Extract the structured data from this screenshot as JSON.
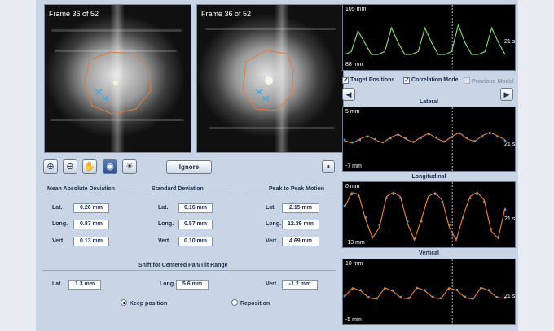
{
  "images": {
    "left_frame": "Frame 36 of 52",
    "right_frame": "Frame 36 of 52"
  },
  "toolbar": {
    "zoom_in_icon": "⊕",
    "zoom_out_icon": "⊖",
    "pan_icon": "✋",
    "window_level_icon": "◉",
    "brightness_icon": "☀",
    "ignore_label": "Ignore",
    "save_icon": "▪"
  },
  "stats": {
    "mean_abs_dev": {
      "title": "Mean Absolute Deviation",
      "rows": [
        {
          "label": "Lat.",
          "value": "0.26 mm"
        },
        {
          "label": "Long.",
          "value": "0.87 mm"
        },
        {
          "label": "Vert.",
          "value": "0.13 mm"
        }
      ]
    },
    "std_dev": {
      "title": "Standard Deviation",
      "rows": [
        {
          "label": "Lat.",
          "value": "0.16 mm"
        },
        {
          "label": "Long.",
          "value": "0.57 mm"
        },
        {
          "label": "Vert.",
          "value": "0.10 mm"
        }
      ]
    },
    "peak_to_peak": {
      "title": "Peak to Peak Motion",
      "rows": [
        {
          "label": "Lat.",
          "value": "2.15 mm"
        },
        {
          "label": "Long.",
          "value": "12.39 mm"
        },
        {
          "label": "Vert.",
          "value": "4.69 mm"
        }
      ]
    }
  },
  "shift": {
    "title": "Shift for Centered Pan/Tilt Range",
    "lat_label": "Lat.",
    "lat_value": "1.3 mm",
    "long_label": "Long.",
    "long_value": "5.6 mm",
    "vert_label": "Vert.",
    "vert_value": "-1.2 mm"
  },
  "options": {
    "keep_position": "Keep position",
    "reposition": "Reposition",
    "selected": "keep_position"
  },
  "checkboxes": {
    "target_positions": "Target Positions",
    "correlation_model": "Correlation Model",
    "previous_model": "Previous Model"
  },
  "nav": {
    "prev": "◀",
    "next": "▶"
  },
  "colors": {
    "breathing_trace": "#7fd36a",
    "model_trace": "#e07a2e",
    "target_points": "#3da6e8",
    "contour": "#e07a3c"
  },
  "chart_data": [
    {
      "type": "line",
      "title": "",
      "ymax_label": "105 mm",
      "ymin_label": "88 mm",
      "time_label": "21 s",
      "ylim": [
        88,
        105
      ],
      "series": [
        {
          "values": [
            91,
            92,
            99,
            95,
            91,
            91,
            92,
            100,
            95,
            91,
            91,
            92,
            100,
            95,
            91,
            91,
            92,
            101,
            95,
            91,
            91,
            92,
            100,
            95,
            91
          ]
        }
      ]
    },
    {
      "type": "line",
      "title": "Lateral",
      "ymax_label": "5 mm",
      "ymin_label": "-7 mm",
      "time_label": "21 s",
      "ylim": [
        -7,
        5
      ],
      "series": [
        {
          "values": [
            -1.0,
            -1.6,
            -1.0,
            -0.2,
            -0.8,
            -1.6,
            -0.6,
            0.2,
            -0.6,
            -1.5,
            -0.5,
            0.4,
            -0.4,
            -1.4,
            -0.4,
            0.6,
            -0.5,
            -1.3,
            -0.2,
            0.6,
            -0.2,
            -1.2
          ]
        },
        {
          "values": [
            -1.2,
            -1.8,
            -0.8,
            0.0,
            -1.0,
            -1.7,
            -0.4,
            0.4,
            -0.8,
            -1.6,
            -0.3,
            0.6,
            -0.6,
            -1.5,
            -0.2,
            0.8,
            -0.7,
            -1.4,
            0.0,
            0.9,
            0.0,
            -1.0
          ]
        }
      ]
    },
    {
      "type": "line",
      "title": "Longitudinal",
      "ymax_label": "0 mm",
      "ymin_label": "-13 mm",
      "time_label": "21 s",
      "ylim": [
        -13,
        0
      ],
      "series": [
        {
          "values": [
            -4,
            -1,
            -1.5,
            -7,
            -12,
            -9,
            -2,
            -1,
            -2,
            -8,
            -12.5,
            -8,
            -2,
            -1,
            -3,
            -9,
            -12.5,
            -7,
            -2,
            -1,
            -3,
            -10,
            -12,
            -5
          ]
        },
        {
          "values": [
            -4.5,
            -0.6,
            -1,
            -7.5,
            -12.3,
            -9.5,
            -1.6,
            -0.5,
            -1.6,
            -8.5,
            -12.8,
            -7.5,
            -1.5,
            -0.6,
            -2.6,
            -9.5,
            -12.9,
            -6.5,
            -1.5,
            -0.5,
            -2.5,
            -10.5,
            -12.4,
            -4.5
          ]
        }
      ]
    },
    {
      "type": "line",
      "title": "Vertical",
      "ymax_label": "10 mm",
      "ymin_label": "-5 mm",
      "time_label": "21 s",
      "ylim": [
        -5,
        10
      ],
      "series": [
        {
          "values": [
            1.5,
            3.8,
            3.3,
            1.2,
            0.8,
            3.8,
            3.2,
            1.2,
            0.9,
            3.9,
            3.3,
            1.3,
            0.9,
            3.8,
            3.4,
            1.3,
            0.8,
            3.9,
            3.3,
            1.2,
            1.0
          ]
        },
        {
          "values": [
            1.4,
            4.0,
            3.1,
            1.0,
            0.6,
            4.0,
            3.0,
            1.0,
            0.7,
            4.1,
            3.1,
            1.1,
            0.7,
            4.0,
            3.2,
            1.1,
            0.6,
            4.1,
            3.1,
            1.0,
            0.9
          ]
        }
      ]
    }
  ]
}
